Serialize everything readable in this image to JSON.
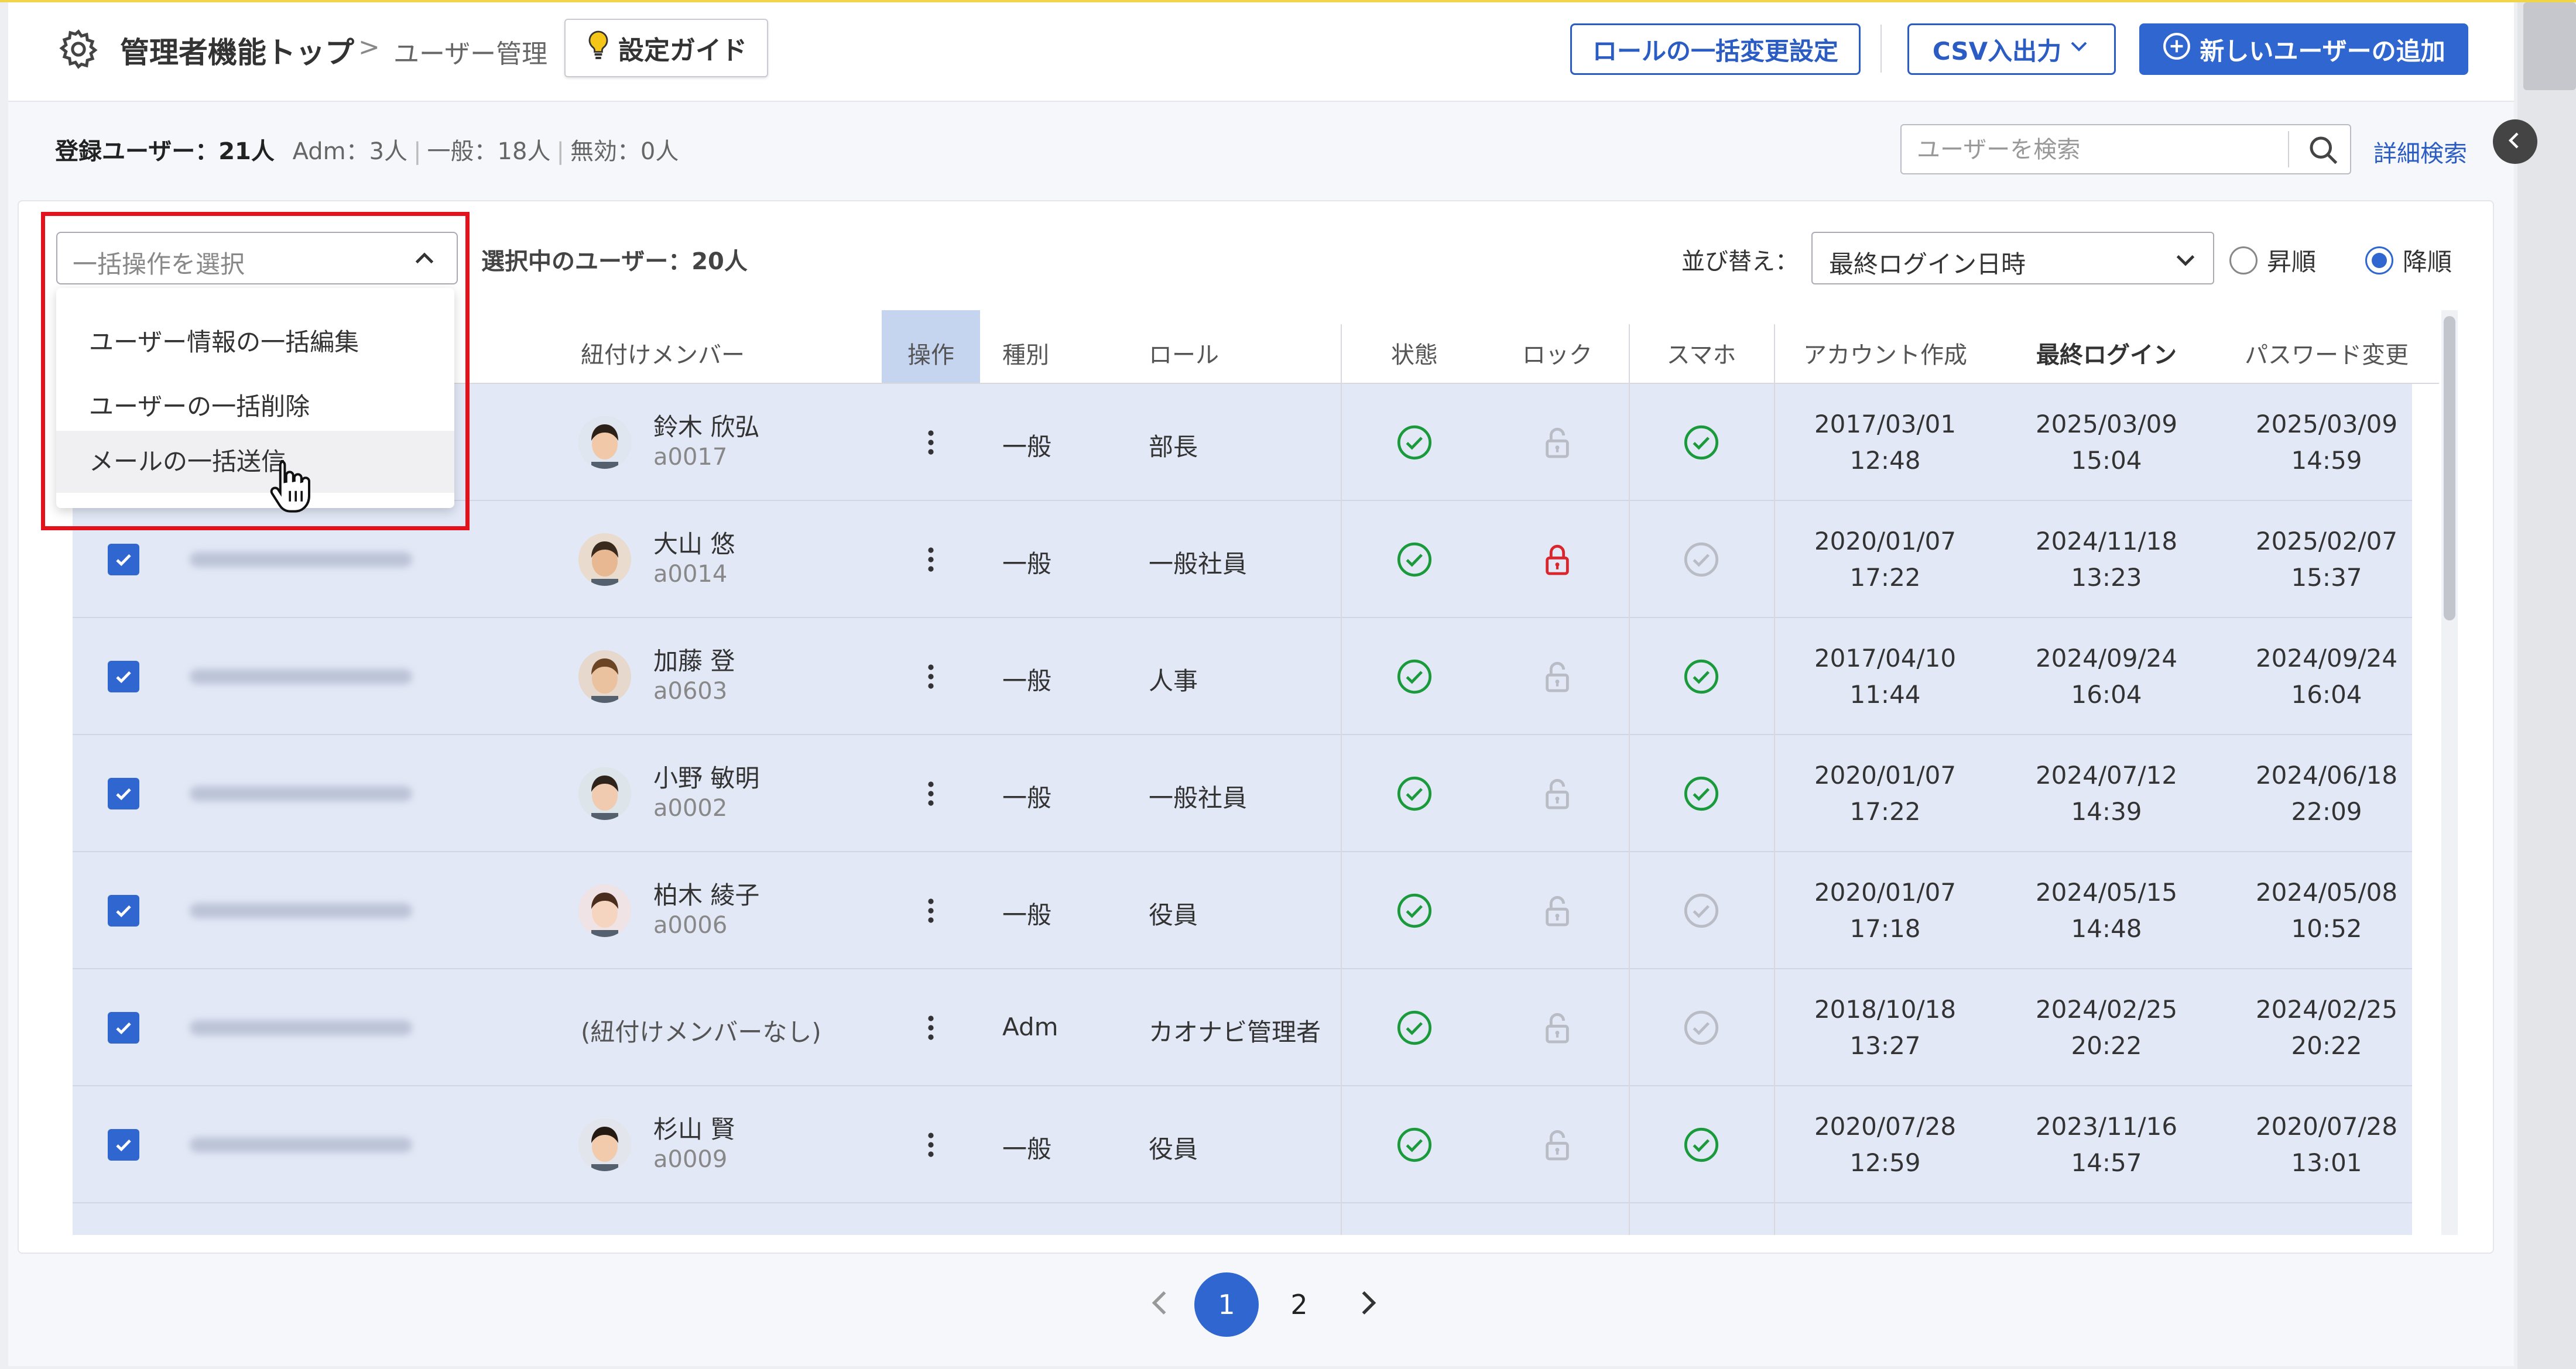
{
  "header": {
    "title": "管理者機能トップ",
    "crumb_sep": ">",
    "crumb": "ユーザー管理",
    "guide_label": "設定ガイド",
    "role_bulk_label": "ロールの一括変更設定",
    "csv_label": "CSV入出力",
    "add_user_label": "新しいユーザーの追加"
  },
  "stats": {
    "registered_label": "登録ユーザー：21人",
    "adm": "Adm：3人",
    "general": "一般：18人",
    "disabled": "無効：0人"
  },
  "search": {
    "placeholder": "ユーザーを検索",
    "advanced_label": "詳細検索"
  },
  "toolbar": {
    "bulk_placeholder": "一括操作を選択",
    "selected_label": "選択中のユーザー：20人",
    "sort_label": "並び替え：",
    "sort_value": "最終ログイン日時",
    "asc_label": "昇順",
    "desc_label": "降順",
    "sort_order_selected": "降順"
  },
  "bulk_menu": {
    "items": [
      {
        "label": "ユーザー情報の一括編集"
      },
      {
        "label": "ユーザーの一括削除"
      },
      {
        "label": "メールの一括送信"
      }
    ],
    "hovered_index": 2
  },
  "table": {
    "columns": {
      "member": "紐付けメンバー",
      "op": "操作",
      "type": "種別",
      "role": "ロール",
      "status": "状態",
      "lock": "ロック",
      "phone": "スマホ",
      "created": "アカウント作成",
      "last_login": "最終ログイン",
      "pw_change": "パスワード変更"
    },
    "rows": [
      {
        "member": "鈴木 欣弘",
        "id": "a0017",
        "type": "一般",
        "role": "部長",
        "active": true,
        "locked": false,
        "phone": true,
        "created_d": "2017/03/01",
        "created_t": "12:48",
        "login_d": "2025/03/09",
        "login_t": "15:04",
        "pw_d": "2025/03/09",
        "pw_t": "14:59"
      },
      {
        "member": "大山 悠",
        "id": "a0014",
        "type": "一般",
        "role": "一般社員",
        "active": true,
        "locked": true,
        "phone": false,
        "created_d": "2020/01/07",
        "created_t": "17:22",
        "login_d": "2024/11/18",
        "login_t": "13:23",
        "pw_d": "2025/02/07",
        "pw_t": "15:37"
      },
      {
        "member": "加藤 登",
        "id": "a0603",
        "type": "一般",
        "role": "人事",
        "active": true,
        "locked": false,
        "phone": true,
        "created_d": "2017/04/10",
        "created_t": "11:44",
        "login_d": "2024/09/24",
        "login_t": "16:04",
        "pw_d": "2024/09/24",
        "pw_t": "16:04"
      },
      {
        "member": "小野 敏明",
        "id": "a0002",
        "type": "一般",
        "role": "一般社員",
        "active": true,
        "locked": false,
        "phone": true,
        "created_d": "2020/01/07",
        "created_t": "17:22",
        "login_d": "2024/07/12",
        "login_t": "14:39",
        "pw_d": "2024/06/18",
        "pw_t": "22:09"
      },
      {
        "member": "柏木 綾子",
        "id": "a0006",
        "type": "一般",
        "role": "役員",
        "active": true,
        "locked": false,
        "phone": false,
        "created_d": "2020/01/07",
        "created_t": "17:18",
        "login_d": "2024/05/15",
        "login_t": "14:48",
        "pw_d": "2024/05/08",
        "pw_t": "10:52"
      },
      {
        "member": "(紐付けメンバーなし)",
        "id": "",
        "type": "Adm",
        "role": "カオナビ管理者",
        "active": true,
        "locked": false,
        "phone": false,
        "created_d": "2018/10/18",
        "created_t": "13:27",
        "login_d": "2024/02/25",
        "login_t": "20:22",
        "pw_d": "2024/02/25",
        "pw_t": "20:22"
      },
      {
        "member": "杉山 賢",
        "id": "a0009",
        "type": "一般",
        "role": "役員",
        "active": true,
        "locked": false,
        "phone": true,
        "created_d": "2020/07/28",
        "created_t": "12:59",
        "login_d": "2023/11/16",
        "login_t": "14:57",
        "pw_d": "2020/07/28",
        "pw_t": "13:01"
      }
    ]
  },
  "pagination": {
    "pages": [
      "1",
      "2"
    ],
    "current": "1"
  },
  "colors": {
    "primary": "#2f66d0",
    "selected_row": "#e2e8f6",
    "ok_green": "#1a9a3a",
    "lock_red": "#d9252b",
    "highlight_frame": "#e3131d"
  }
}
